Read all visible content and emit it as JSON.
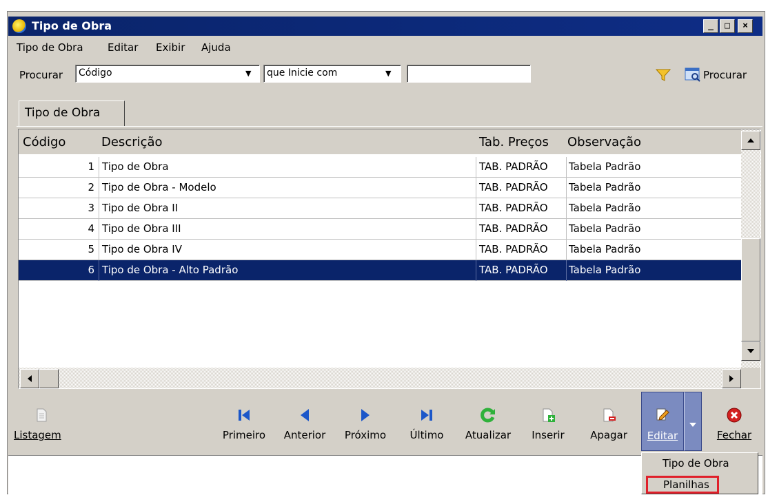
{
  "window": {
    "title": "Tipo de Obra",
    "minimize": "_",
    "maximize": "□",
    "close": "×"
  },
  "menu": [
    {
      "label": "Tipo de Obra"
    },
    {
      "label": "Editar"
    },
    {
      "label": "Exibir"
    },
    {
      "label": "Ajuda"
    }
  ],
  "search": {
    "label": "Procurar",
    "field_value": "Código",
    "condition_value": "que Inicie com",
    "text_value": "",
    "button_label": "Procurar"
  },
  "tab": {
    "label": "Tipo de Obra"
  },
  "grid": {
    "columns": [
      "Código",
      "Descrição",
      "Tab. Preços",
      "Observação"
    ],
    "rows": [
      {
        "code": "1",
        "desc": "Tipo de Obra",
        "tab": "TAB. PADRÃO",
        "obs": "Tabela Padrão"
      },
      {
        "code": "2",
        "desc": "Tipo de Obra - Modelo",
        "tab": "TAB. PADRÃO",
        "obs": "Tabela Padrão"
      },
      {
        "code": "3",
        "desc": "Tipo de Obra II",
        "tab": "TAB. PADRÃO",
        "obs": "Tabela Padrão"
      },
      {
        "code": "4",
        "desc": "Tipo de Obra III",
        "tab": "TAB. PADRÃO",
        "obs": "Tabela Padrão"
      },
      {
        "code": "5",
        "desc": "Tipo de Obra IV",
        "tab": "TAB. PADRÃO",
        "obs": "Tabela Padrão"
      },
      {
        "code": "6",
        "desc": "Tipo de Obra - Alto Padrão",
        "tab": "TAB. PADRÃO",
        "obs": "Tabela Padrão"
      }
    ],
    "selected_row": 6
  },
  "toolbar": {
    "listagem": "Listagem",
    "primeiro": "Primeiro",
    "anterior": "Anterior",
    "proximo": "Próximo",
    "ultimo": "Último",
    "atualizar": "Atualizar",
    "inserir": "Inserir",
    "apagar": "Apagar",
    "editar": "Editar",
    "fechar": "Fechar"
  },
  "popup_menu": [
    {
      "label": "Tipo de Obra"
    },
    {
      "label": "Planilhas"
    }
  ],
  "colors": {
    "title_bar": "#0a246a",
    "selection": "#0a246a",
    "face": "#d4d0c8",
    "nav_icon": "#1c57c9",
    "refresh_icon": "#2fb13b",
    "close_icon": "#d32020",
    "highlight_box": "#e0202a"
  }
}
